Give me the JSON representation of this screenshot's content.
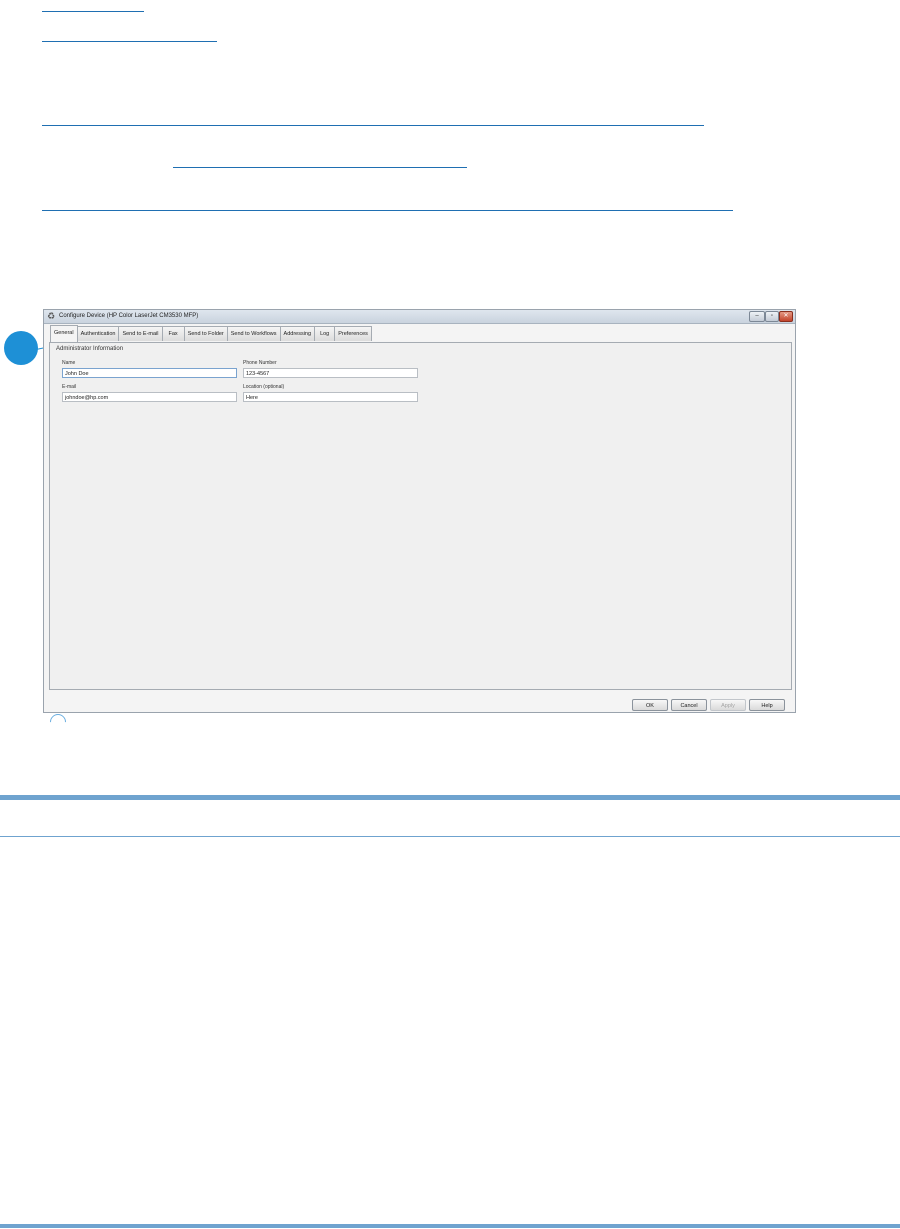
{
  "window": {
    "title": "Configure Device (HP Color LaserJet CM3530 MFP)",
    "controls": [
      "–",
      "▫",
      "✕"
    ]
  },
  "tabs": [
    {
      "label": "General",
      "active": true
    },
    {
      "label": "Authentication",
      "active": false
    },
    {
      "label": "Send to E-mail",
      "active": false
    },
    {
      "label": "Fax",
      "active": false
    },
    {
      "label": "Send to Folder",
      "active": false
    },
    {
      "label": "Send to Workflows",
      "active": false
    },
    {
      "label": "Addressing",
      "active": false
    },
    {
      "label": "Log",
      "active": false
    },
    {
      "label": "Preferences",
      "active": false
    }
  ],
  "general": {
    "group_title": "Administrator Information",
    "name_label": "Name",
    "name_value": "John Doe",
    "phone_label": "Phone Number",
    "phone_value": "123-4567",
    "email_label": "E-mail",
    "email_value": "johndoe@hp.com",
    "location_label": "Location (optional)",
    "location_value": "Here"
  },
  "buttons": {
    "ok": "OK",
    "cancel": "Cancel",
    "apply": "Apply",
    "help": "Help"
  },
  "colors": {
    "link": "#1f6fb2",
    "rule": "#6fa3cf",
    "callout": "#1e90d6"
  }
}
